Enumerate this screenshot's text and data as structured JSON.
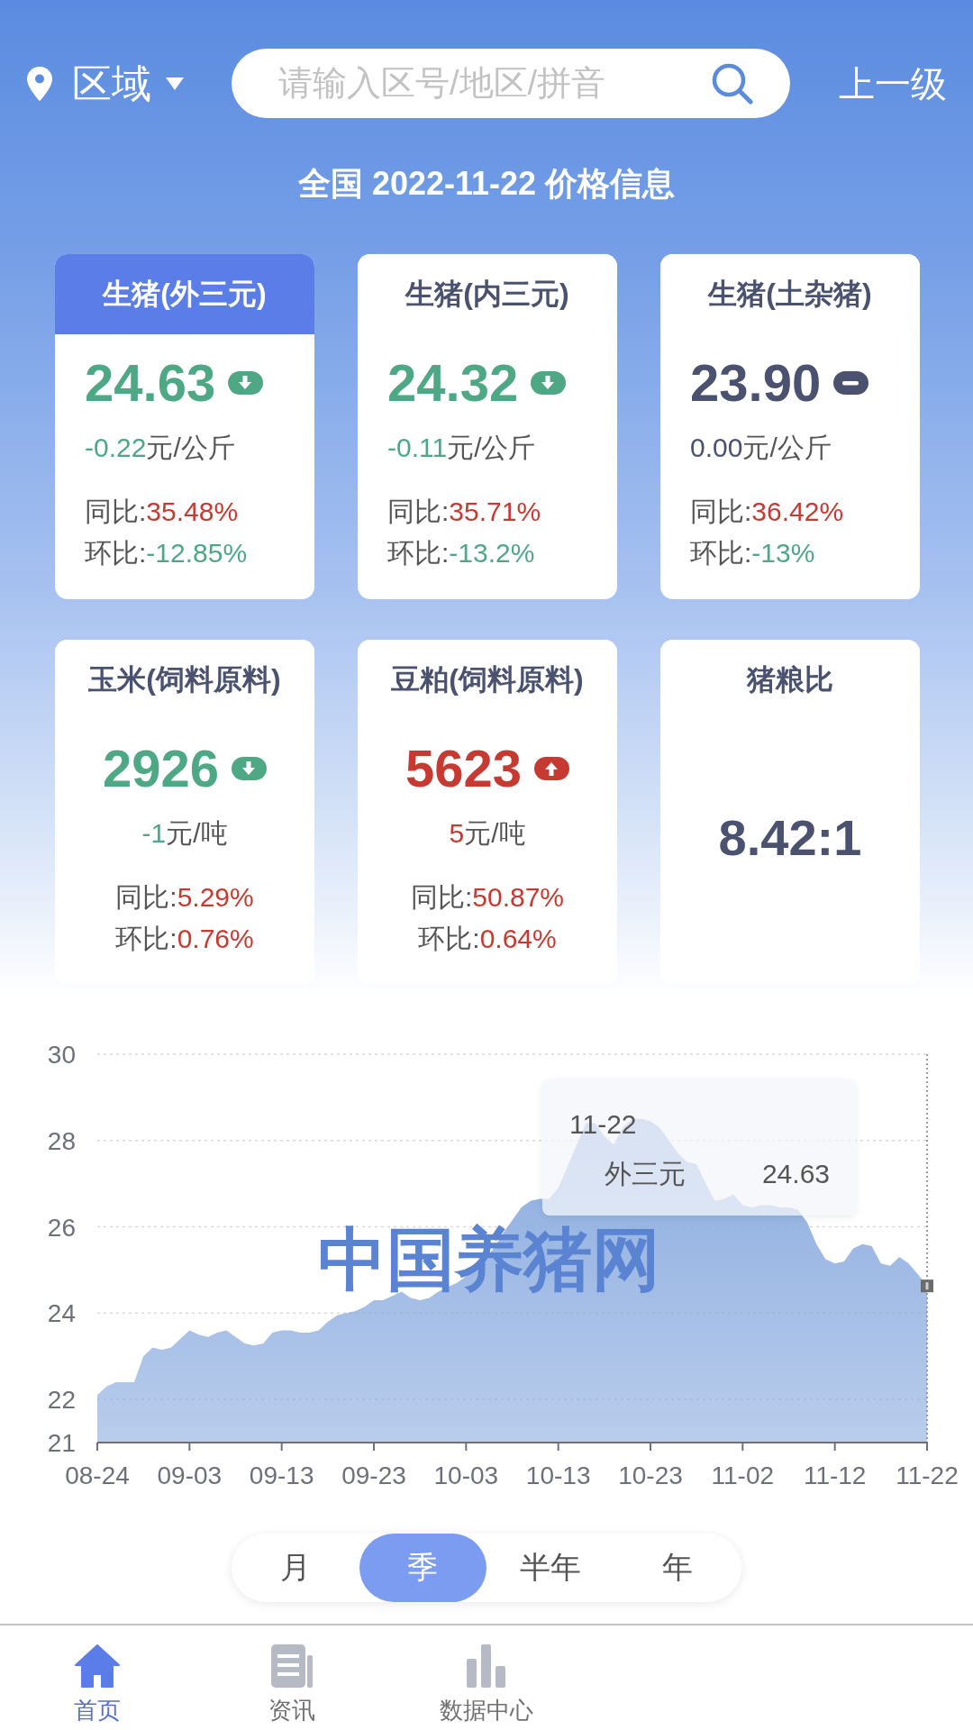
{
  "header": {
    "region": "区域",
    "search": {
      "placeholder": "请输入区号/地区/拼音"
    },
    "back": "上一级"
  },
  "title": "全国 2022-11-22 价格信息",
  "cards": [
    {
      "kind": "pig",
      "title": "生猪(外三元)",
      "selected": true,
      "price": "24.63",
      "rising": false,
      "falling": true,
      "change": "-0.22",
      "unit": "元/公斤",
      "stats": [
        {
          "label": "同比:",
          "value": "35.48%",
          "color": "#c73a31"
        },
        {
          "label": "环比:",
          "value": "-12.85%",
          "color": "#4ea886"
        }
      ]
    },
    {
      "kind": "pig",
      "title": "生猪(内三元)",
      "selected": false,
      "price": "24.32",
      "rising": false,
      "falling": true,
      "change": "-0.11",
      "unit": "元/公斤",
      "stats": [
        {
          "label": "同比:",
          "value": "35.71%",
          "color": "#c73a31"
        },
        {
          "label": "环比:",
          "value": "-13.2%",
          "color": "#4ea886"
        }
      ]
    },
    {
      "kind": "pig",
      "title": "生猪(土杂猪)",
      "selected": false,
      "price": "23.90",
      "rising": false,
      "falling": false,
      "change": "0.00",
      "unit": "元/公斤",
      "stats": [
        {
          "label": "同比:",
          "value": "36.42%",
          "color": "#c73a31"
        },
        {
          "label": "环比:",
          "value": "-13%",
          "color": "#4ea886"
        }
      ]
    },
    {
      "kind": "feed",
      "title": "玉米(饲料原料)",
      "selected": false,
      "price": "2926",
      "rising": false,
      "falling": true,
      "change": "-1",
      "unit": "元/吨",
      "stats": [
        {
          "label": "同比:",
          "value": "5.29%",
          "color": "#c73a31"
        },
        {
          "label": "环比:",
          "value": "0.76%",
          "color": "#c73a31"
        }
      ]
    },
    {
      "kind": "feed",
      "title": "豆粕(饲料原料)",
      "selected": false,
      "price": "5623",
      "rising": true,
      "falling": false,
      "change": "5",
      "unit": "元/吨",
      "stats": [
        {
          "label": "同比:",
          "value": "50.87%",
          "color": "#c73a31"
        },
        {
          "label": "环比:",
          "value": "0.64%",
          "color": "#c73a31"
        }
      ]
    },
    {
      "kind": "ratio",
      "title": "猪粮比",
      "selected": false,
      "value": "8.42:1"
    }
  ],
  "chart": {
    "watermark": "中国养猪网",
    "tooltip": {
      "date": "11-22",
      "value": "24.63"
    },
    "chart_data": {
      "type": "area",
      "grid": true,
      "categories": [
        "08-24",
        null,
        null,
        null,
        null,
        null,
        null,
        null,
        null,
        null,
        "09-03",
        null,
        null,
        null,
        null,
        null,
        null,
        null,
        null,
        null,
        "09-13",
        null,
        null,
        null,
        null,
        null,
        null,
        null,
        null,
        null,
        "09-23",
        null,
        null,
        null,
        null,
        null,
        null,
        null,
        null,
        null,
        "10-03",
        null,
        null,
        null,
        null,
        null,
        null,
        null,
        null,
        null,
        "10-13",
        null,
        null,
        null,
        null,
        null,
        null,
        null,
        null,
        null,
        "10-23",
        null,
        null,
        null,
        null,
        null,
        null,
        null,
        null,
        null,
        "11-02",
        null,
        null,
        null,
        null,
        null,
        null,
        null,
        null,
        null,
        "11-12",
        null,
        null,
        null,
        null,
        null,
        null,
        null,
        null,
        null,
        "11-22"
      ],
      "series": [
        {
          "name": "外三元",
          "color": "#8aabdf",
          "values": [
            22.1,
            22.3,
            22.4,
            22.4,
            22.4,
            23.0,
            23.2,
            23.15,
            23.2,
            23.4,
            23.6,
            23.5,
            23.45,
            23.55,
            23.6,
            23.45,
            23.3,
            23.25,
            23.3,
            23.55,
            23.6,
            23.6,
            23.55,
            23.55,
            23.6,
            23.8,
            23.95,
            24.0,
            24.05,
            24.15,
            24.3,
            24.3,
            24.4,
            24.5,
            24.35,
            24.3,
            24.35,
            24.5,
            24.6,
            24.7,
            24.85,
            25.05,
            25.25,
            25.5,
            25.85,
            26.15,
            26.45,
            26.6,
            26.65,
            26.65,
            26.9,
            27.4,
            27.9,
            28.4,
            28.4,
            28.1,
            27.9,
            28.3,
            28.5,
            28.5,
            28.45,
            28.3,
            28.0,
            27.7,
            27.5,
            27.45,
            27.0,
            26.6,
            26.65,
            26.75,
            26.5,
            26.45,
            26.5,
            26.5,
            26.45,
            26.45,
            26.4,
            26.1,
            25.6,
            25.25,
            25.15,
            25.2,
            25.5,
            25.6,
            25.55,
            25.15,
            25.1,
            25.3,
            25.15,
            24.9,
            24.63
          ]
        }
      ],
      "ylim": [
        21,
        30
      ],
      "yticks": [
        21,
        22,
        24,
        26,
        28,
        30
      ]
    }
  },
  "periods": [
    {
      "label": "月",
      "selected": false
    },
    {
      "label": "季",
      "selected": true
    },
    {
      "label": "半年",
      "selected": false
    },
    {
      "label": "年",
      "selected": false
    }
  ],
  "nav": [
    {
      "label": "首页",
      "selected": true
    },
    {
      "label": "资讯",
      "selected": false
    },
    {
      "label": "数据中心",
      "selected": false
    }
  ]
}
